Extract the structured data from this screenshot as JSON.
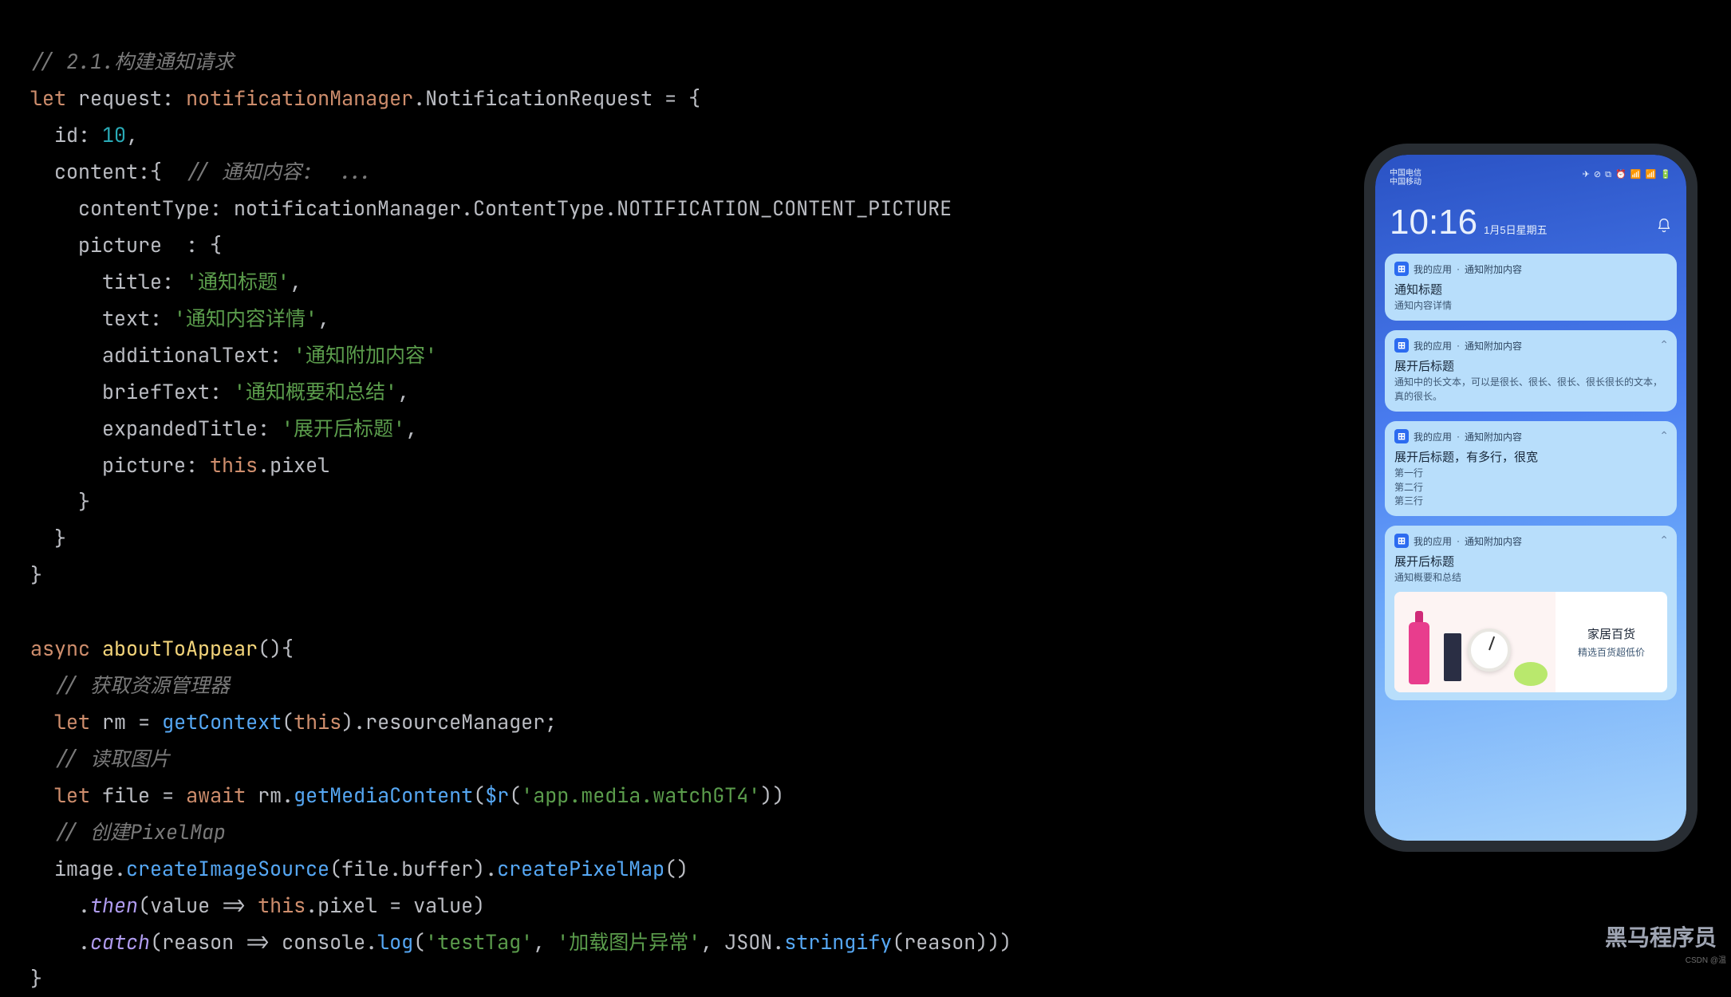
{
  "code": {
    "comment_build": "// 2.1.构建通知请求",
    "kw_let1": "let",
    "ident_request": "request",
    "type_nm": "notificationManager",
    "type_nreq": ".NotificationRequest",
    "eq_brace": " = {",
    "prop_id": "id",
    "val_id": "10",
    "prop_content": "content",
    "comment_content": "// 通知内容:  ...",
    "prop_contentType": "contentType",
    "val_ct_ns": "notificationManager.ContentType.",
    "val_ct_const": "NOTIFICATION_CONTENT_PICTURE",
    "prop_picture": "picture",
    "prop_title": "title",
    "val_title": "'通知标题'",
    "prop_text": "text",
    "val_text": "'通知内容详情'",
    "prop_addlText": "additionalText",
    "val_addlText": "'通知附加内容'",
    "prop_brief": "briefText",
    "val_brief": "'通知概要和总结'",
    "prop_expTitle": "expandedTitle",
    "val_expTitle": "'展开后标题'",
    "prop_pic2": "picture",
    "kw_this1": "this",
    "member_pixel": ".pixel",
    "kw_async": "async",
    "fn_about": "aboutToAppear",
    "comment_rm": "// 获取资源管理器",
    "kw_let2": "let",
    "ident_rm": "rm",
    "fn_getContext": "getContext",
    "kw_this2": "this",
    "member_resMgr": ".resourceManager;",
    "comment_read": "// 读取图片",
    "kw_let3": "let",
    "ident_file": "file",
    "kw_await": "await",
    "ident_rm2": "rm",
    "fn_getMedia": "getMediaContent",
    "fn_dollar_r": "$r",
    "str_media": "'app.media.watchGT4'",
    "comment_pixmap": "// 创建PixelMap",
    "ident_image": "image",
    "fn_createImgSrc": "createImageSource",
    "ident_file2": "file",
    "member_buffer": ".buffer",
    "fn_createPixMap": "createPixelMap",
    "fn_then": "then",
    "ident_value": "value",
    "kw_this3": "this",
    "member_pixel2": ".pixel",
    "ident_value2": "value",
    "fn_catch": "catch",
    "ident_reason": "reason",
    "ident_console": "console",
    "fn_log": "log",
    "str_tag": "'testTag'",
    "str_err": "'加载图片异常'",
    "ident_json": "JSON",
    "fn_stringify": "stringify",
    "ident_reason2": "reason"
  },
  "phone": {
    "carrier": "中国电信\n中国移动",
    "statusicons": "✈ ⊘ ⧉ ⏰ 📶 📶 🔋",
    "clock": "10:16",
    "date": "1月5日星期五",
    "cards": [
      {
        "app": "我的应用",
        "ext": "通知附加内容",
        "title": "通知标题",
        "body": "通知内容详情",
        "chev": false
      },
      {
        "app": "我的应用",
        "ext": "通知附加内容",
        "title": "展开后标题",
        "body": "通知中的长文本，可以是很长、很长、很长、很长很长的文本，真的很长。",
        "chev": true
      },
      {
        "app": "我的应用",
        "ext": "通知附加内容",
        "title": "展开后标题，有多行，很宽",
        "body": "第一行\n第二行\n第三行",
        "chev": true
      },
      {
        "app": "我的应用",
        "ext": "通知附加内容",
        "title": "展开后标题",
        "body": "通知概要和总结",
        "chev": true,
        "pic": true
      }
    ],
    "pic_big": "家居百货",
    "pic_small": "精选百货超低价"
  },
  "watermark": "黑马程序员",
  "watermark2": "CSDN @温"
}
